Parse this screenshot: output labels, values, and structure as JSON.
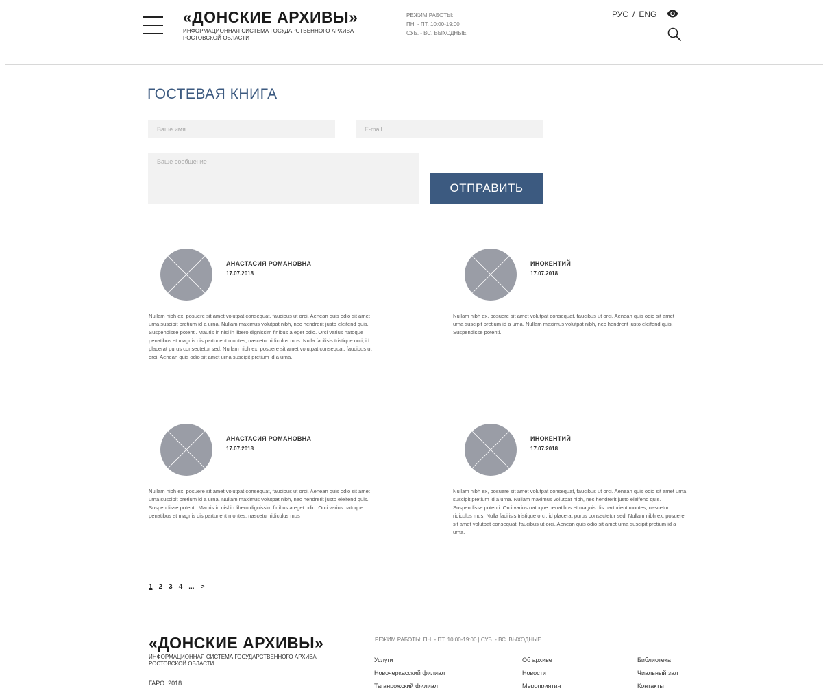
{
  "header": {
    "logo_title": "«ДОНСКИЕ АРХИВЫ»",
    "logo_subtitle": "ИНФОРМАЦИОННАЯ СИСТЕМА ГОСУДАРСТВЕННОГО АРХИВА РОСТОВСКОЙ ОБЛАСТИ",
    "hours_label": "РЕЖИМ РАБОТЫ:",
    "hours_weekdays": "ПН. - ПТ.   10:00-19:00",
    "hours_weekend": "СУБ. - ВС.  ВЫХОДНЫЕ",
    "lang_ru": "РУС",
    "lang_sep": "/",
    "lang_en": "ENG"
  },
  "page": {
    "title": "ГОСТЕВАЯ КНИГА"
  },
  "form": {
    "name_placeholder": "Ваше имя",
    "email_placeholder": "E-mail",
    "message_placeholder": "Ваше сообщение",
    "submit_label": "ОТПРАВИТЬ"
  },
  "reviews": [
    {
      "name": "АНАСТАСИЯ РОМАНОВНА",
      "date": "17.07.2018",
      "text": "Nullam nibh ex, posuere sit amet volutpat consequat, faucibus ut orci. Aenean quis odio sit amet urna suscipit pretium id a urna. Nullam maximus volutpat nibh, nec hendrerit justo eleifend quis. Suspendisse potenti. Mauris in nisl in libero dignissim finibus a eget odio. Orci varius natoque penatibus et magnis dis parturient montes, nascetur ridiculus mus. Nulla facilisis tristique orci, id placerat purus consectetur sed. Nullam nibh ex, posuere sit amet volutpat consequat, faucibus ut orci. Aenean quis odio sit amet urna suscipit pretium id a urna."
    },
    {
      "name": "ИНОКЕНТИЙ",
      "date": "17.07.2018",
      "text": "Nullam nibh ex, posuere sit amet volutpat consequat, faucibus ut orci. Aenean quis odio sit amet urna suscipit pretium id a urna. Nullam maximus volutpat nibh, nec hendrerit justo eleifend quis. Suspendisse potenti."
    },
    {
      "name": "АНАСТАСИЯ РОМАНОВНА",
      "date": "17.07.2018",
      "text": "Nullam nibh ex, posuere sit amet volutpat consequat, faucibus ut orci. Aenean quis odio sit amet urna suscipit pretium id a urna. Nullam maximus volutpat nibh, nec hendrerit justo eleifend quis. Suspendisse potenti. Mauris in nisl in libero dignissim finibus a eget odio. Orci varius natoque penatibus et magnis dis parturient montes, nascetur ridiculus mus"
    },
    {
      "name": "ИНОКЕНТИЙ",
      "date": "17.07.2018",
      "text": "Nullam nibh ex, posuere sit amet volutpat consequat, faucibus ut orci. Aenean quis odio sit amet urna suscipit pretium id a urna. Nullam maximus volutpat nibh, nec hendrerit justo eleifend quis. Suspendisse potenti. Orci varius natoque penatibus et magnis dis parturient montes, nascetur ridiculus mus. Nulla facilisis tristique orci, id placerat purus consectetur sed. Nullam nibh ex, posuere sit amet volutpat consequat, faucibus ut orci. Aenean quis odio sit amet urna suscipit pretium id a urna."
    }
  ],
  "pagination": {
    "pages": [
      "1",
      "2",
      "3",
      "4",
      "...",
      ">"
    ],
    "current": "1"
  },
  "footer": {
    "logo_title": "«ДОНСКИЕ АРХИВЫ»",
    "logo_subtitle": "ИНФОРМАЦИОННАЯ СИСТЕМА ГОСУДАРСТВЕННОГО АРХИВА РОСТОВСКОЙ ОБЛАСТИ",
    "copyright": "ГАРО. 2018",
    "hours": "РЕЖИМ РАБОТЫ: ПН. - ПТ. 10:00-19:00   |   СУБ. - ВС. ВЫХОДНЫЕ",
    "col1": [
      "Услуги",
      "Новочеркасский филиал",
      "Таганрожский филиал"
    ],
    "col2": [
      "Об архиве",
      "Новости",
      "Мероприятия"
    ],
    "col3": [
      "Библиотека",
      "Чиальный зал",
      "Контакты"
    ]
  },
  "colors": {
    "accent": "#3c5a80",
    "avatar": "#9a9da6",
    "field_bg": "#f2f2f2"
  },
  "icons": [
    "menu-icon",
    "eye-icon",
    "search-icon",
    "avatar-placeholder-icon"
  ]
}
